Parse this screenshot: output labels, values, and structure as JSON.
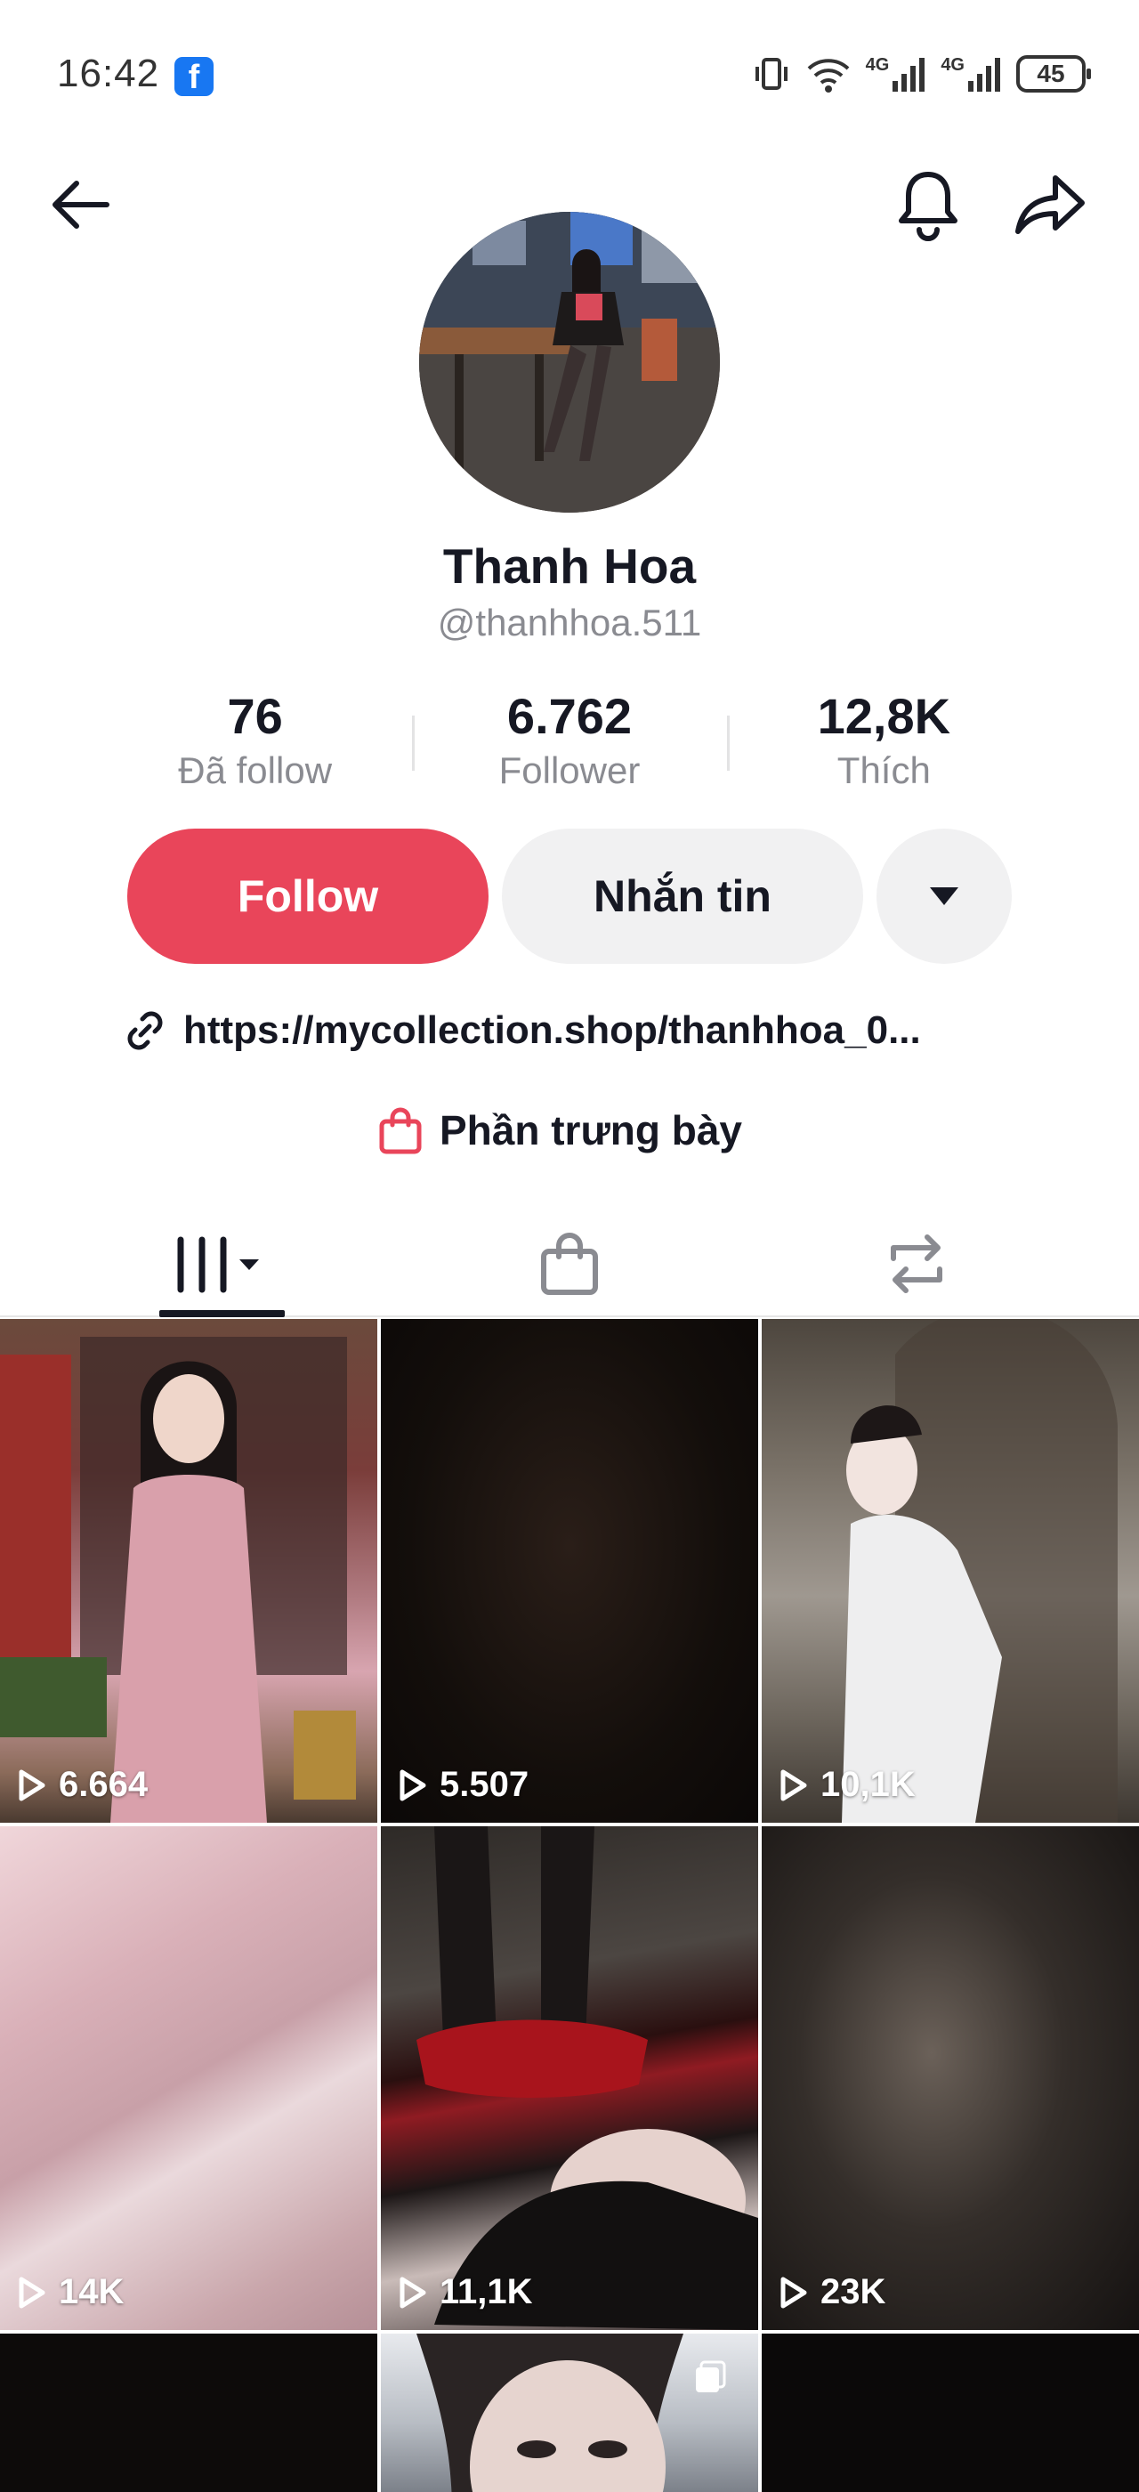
{
  "status_bar": {
    "time": "16:42",
    "app_badge": "f",
    "network_1": "4G",
    "network_2": "4G",
    "battery": "45"
  },
  "header": {
    "back_icon": "arrow-left-icon",
    "bell_icon": "bell-icon",
    "share_icon": "share-arrow-icon"
  },
  "profile": {
    "name": "Thanh Hoa",
    "handle": "@thanhhoa.511",
    "stats": [
      {
        "value": "76",
        "label": "Đã follow"
      },
      {
        "value": "6.762",
        "label": "Follower"
      },
      {
        "value": "12,8K",
        "label": "Thích"
      }
    ]
  },
  "actions": {
    "follow_label": "Follow",
    "message_label": "Nhắn tin",
    "more_icon": "caret-down-icon"
  },
  "bio": {
    "link_icon": "link-icon",
    "link_text": "https://mycollection.shop/thanhhoa_0...",
    "showcase_icon": "shopping-bag-icon",
    "showcase_text": "Phần trưng bày"
  },
  "tabs": [
    {
      "name": "videos",
      "icon": "grid-videos-icon",
      "active": true
    },
    {
      "name": "shop",
      "icon": "shopping-bag-icon",
      "active": false
    },
    {
      "name": "repost",
      "icon": "repost-icon",
      "active": false
    }
  ],
  "colors": {
    "accent": "#e9455a",
    "text_primary": "#161823",
    "text_secondary": "#8a8b91",
    "button_secondary": "#f1f1f2"
  },
  "videos": [
    {
      "views": "6.664"
    },
    {
      "views": "5.507"
    },
    {
      "views": "10,1K"
    },
    {
      "views": "14K"
    },
    {
      "views": "11,1K"
    },
    {
      "views": "23K"
    },
    {
      "views": ""
    },
    {
      "views": "",
      "pinned_icon": "pin-icon"
    },
    {
      "views": ""
    }
  ]
}
